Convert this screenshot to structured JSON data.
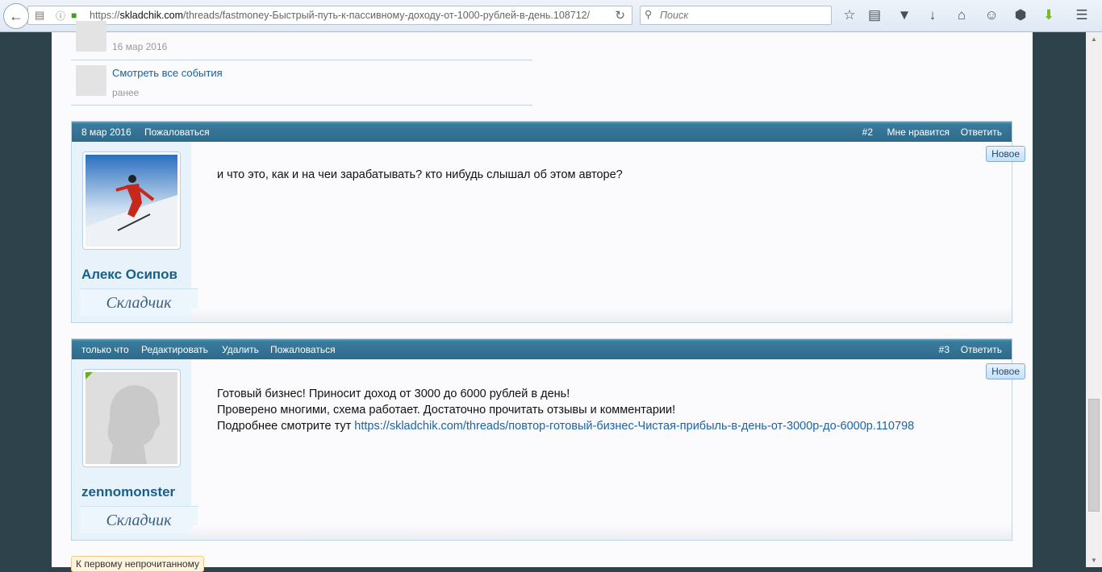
{
  "browser": {
    "url_prefix": "https://",
    "url_domain": "skladchik.com",
    "url_path": "/threads/fastmoney-Быстрый-путь-к-пассивному-доходу-от-1000-рублей-в-день.108712/",
    "search_placeholder": "Поиск"
  },
  "events": [
    {
      "date": "16 мар 2016"
    },
    {
      "link": "Смотреть все события",
      "date": "ранее"
    }
  ],
  "posts": [
    {
      "date": "8 мар 2016",
      "actions": [
        "Пожаловаться"
      ],
      "number": "#2",
      "right_actions": [
        "Мне нравится",
        "Ответить"
      ],
      "badge": "Новое",
      "username": "Алекс Осипов",
      "rank": "Складчик",
      "lines": [
        "и что это, как и на чеи зарабатывать? кто нибудь слышал об этом авторе?"
      ]
    },
    {
      "date": "только что",
      "actions": [
        "Редактировать",
        "Удалить",
        "Пожаловаться"
      ],
      "number": "#3",
      "right_actions": [
        "Ответить"
      ],
      "badge": "Новое",
      "username": "zennomonster",
      "rank": "Складчик",
      "lines": [
        "Готовый бизнес! Приносит доход от 3000 до 6000 рублей в день!",
        "Проверено многими, схема работает. Достаточно прочитать отзывы и комментарии!",
        "Подробнее смотрите тут "
      ],
      "link": "https://skladchik.com/threads/повтор-готовый-бизнес-Чистая-прибыль-в-день-от-3000р-до-6000р.110798"
    }
  ],
  "unread_button": "К первому непрочитанному"
}
